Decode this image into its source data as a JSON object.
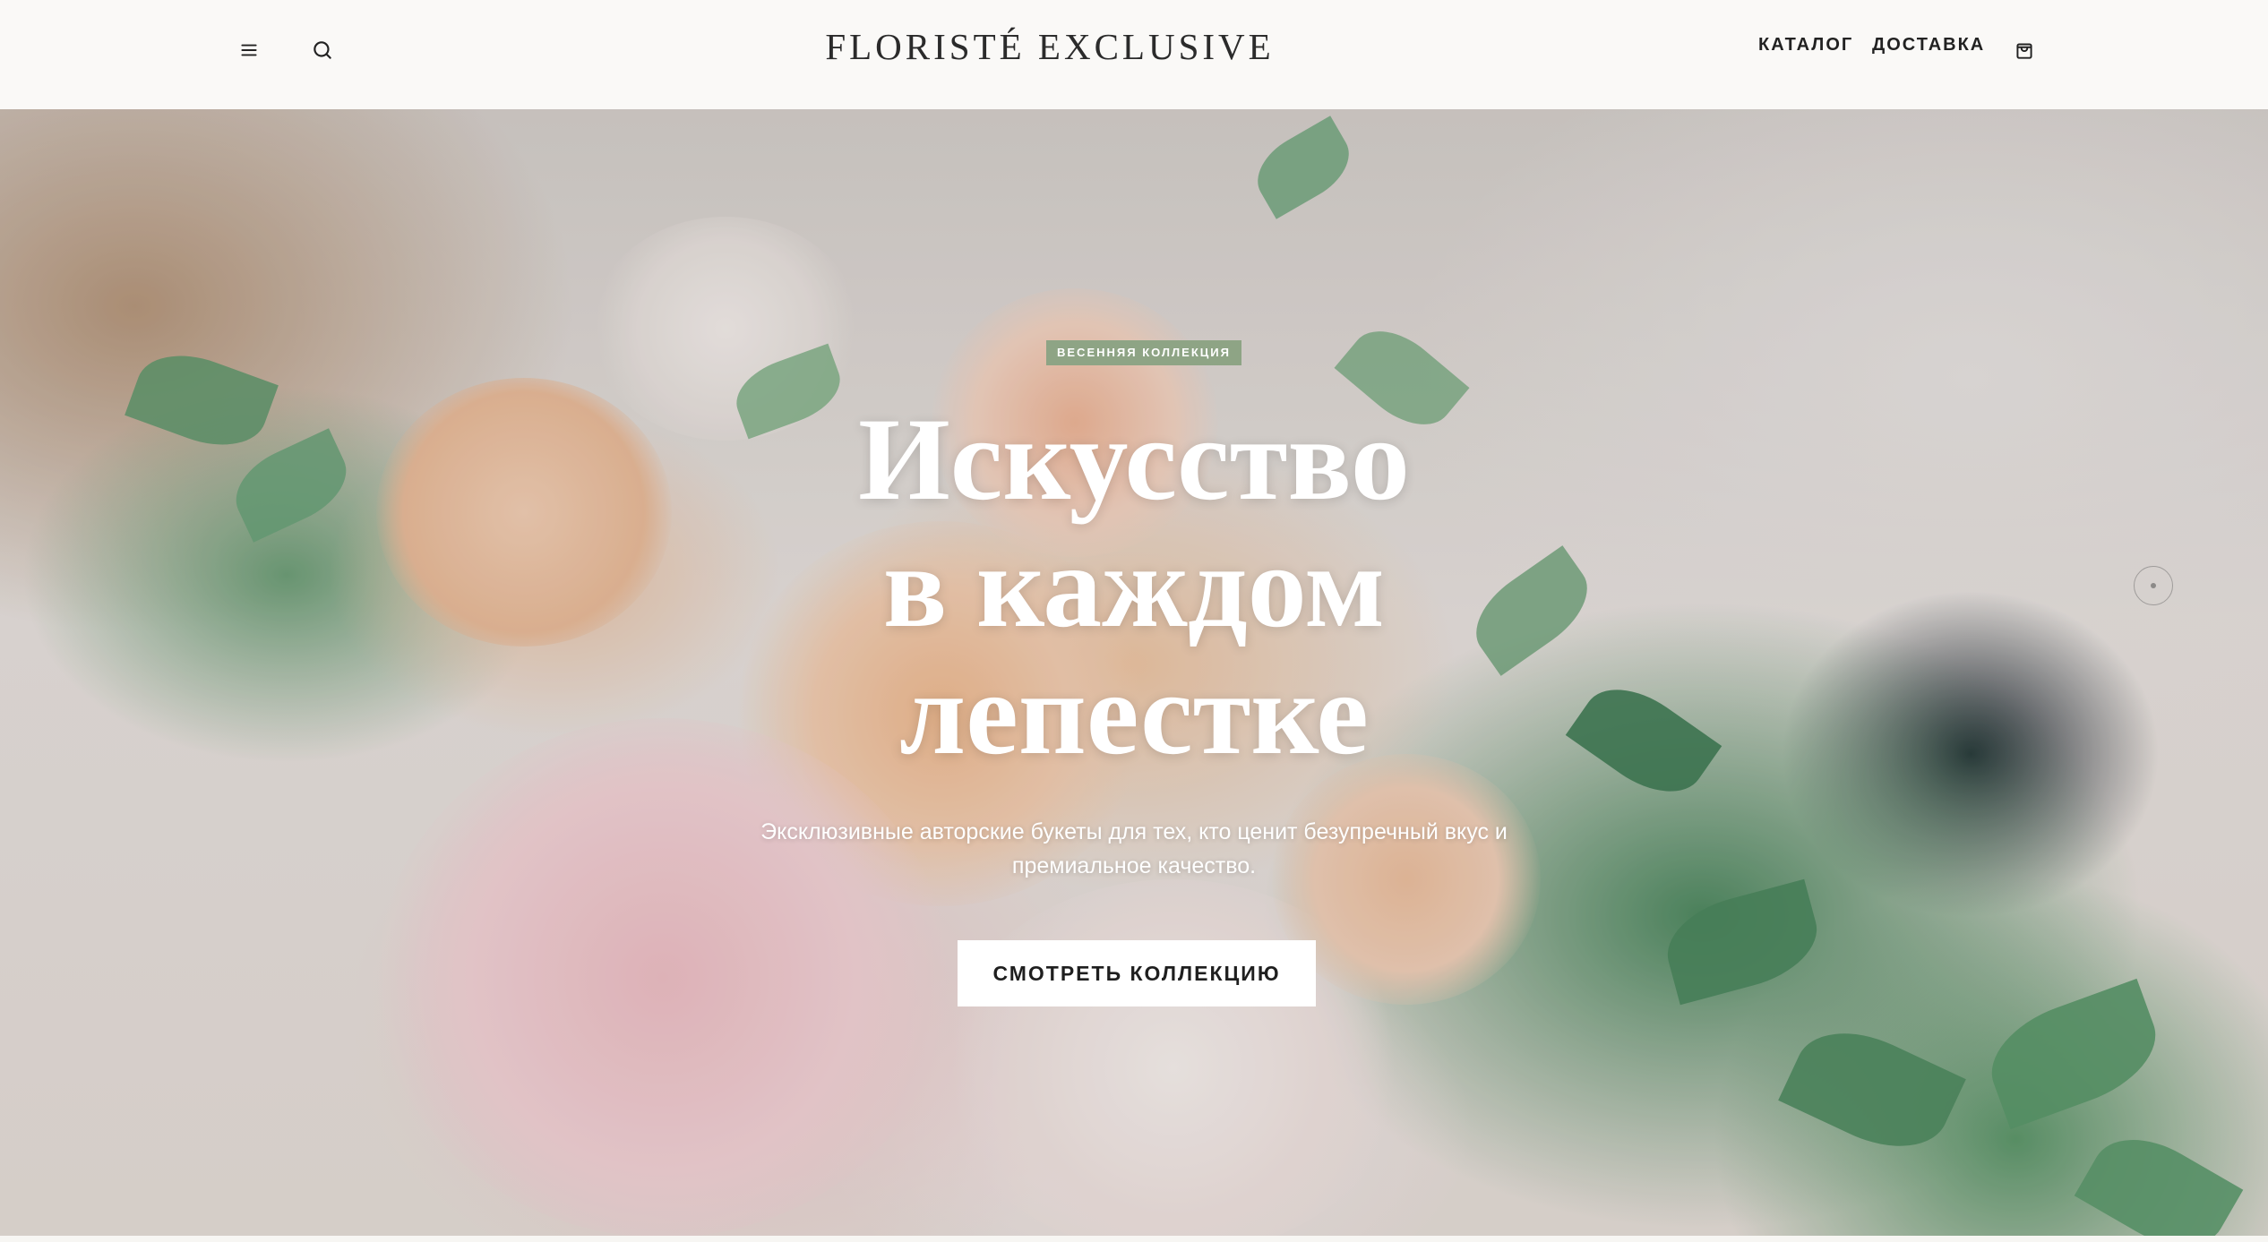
{
  "header": {
    "brand": "FLORISTÉ EXCLUSIVE",
    "menu_icon": "menu-icon",
    "search_icon": "search-icon",
    "cart_icon": "shopping-bag-icon",
    "nav": [
      {
        "label": "КАТАЛОГ"
      },
      {
        "label": "ДОСТАВКА"
      }
    ]
  },
  "hero": {
    "badge": "ВЕСЕННЯЯ КОЛЛЕКЦИЯ",
    "headline": [
      "Искусство",
      "в каждом",
      "лепестке"
    ],
    "subtitle_line1": "Эксклюзивные авторские букеты для тех, кто ценит безупречный вкус и",
    "subtitle_line2": "премиальное качество.",
    "cta_label": "СМОТРЕТЬ КОЛЛЕКЦИЮ",
    "scroll_icon": "scroll-indicator-icon"
  },
  "colors": {
    "header_bg": "#faf9f7",
    "badge_bg": "#8ea485",
    "text_dark": "#222222",
    "cta_bg": "#ffffff"
  }
}
